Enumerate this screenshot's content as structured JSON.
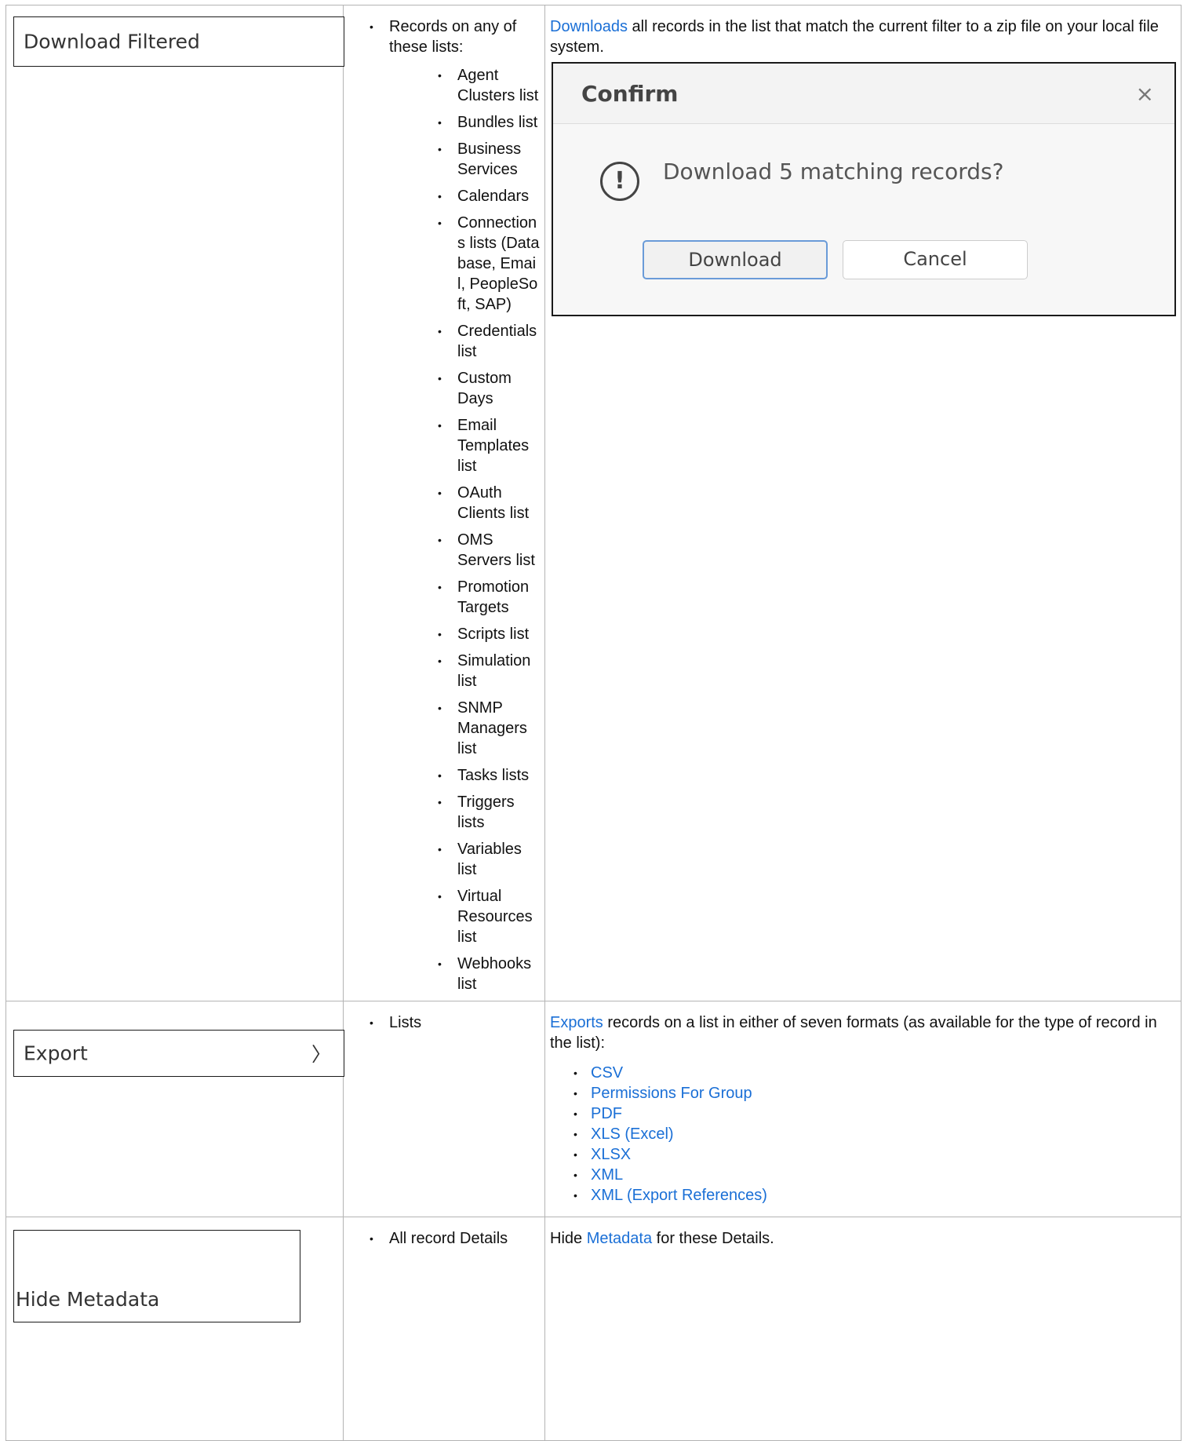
{
  "rows": [
    {
      "menu_label": "Download Filtered",
      "applies_intro": "Records on any of these lists:",
      "lists": [
        "Agent Clusters list",
        "Bundles list",
        "Business Services",
        "Calendars",
        "Connections lists (Database, Email, PeopleSoft, SAP)",
        "Credentials list",
        "Custom Days",
        "Email Templates list",
        "OAuth Clients list",
        "OMS Servers list",
        "Promotion Targets",
        "Scripts list",
        "Simulation list",
        "SNMP Managers list",
        "Tasks lists",
        "Triggers lists",
        "Variables list",
        "Virtual Resources list",
        "Webhooks list"
      ],
      "desc_link": "Downloads",
      "desc_text": " all records in the list that match the current filter to a zip file on your local file system.",
      "dialog": {
        "title": "Confirm",
        "close": "×",
        "icon": "!",
        "message": "Download 5 matching records?",
        "primary": "Download",
        "cancel": "Cancel"
      }
    },
    {
      "menu_label": "Export",
      "menu_chevron": "〉",
      "applies": "Lists",
      "desc_link": "Exports",
      "desc_text": " records on a list in either of seven formats (as available for the type of record in the list):",
      "formats": [
        "CSV",
        "Permissions For Group",
        "PDF",
        "XLS (Excel)",
        "XLSX",
        "XML",
        "XML (Export References)"
      ]
    },
    {
      "menu_label": "Hide Metadata",
      "applies": "All record Details",
      "desc_prefix": "Hide ",
      "desc_link": "Metadata",
      "desc_text": " for these Details."
    }
  ],
  "colors": {
    "link": "#1a6fd6",
    "border": "#b4b4b4"
  }
}
